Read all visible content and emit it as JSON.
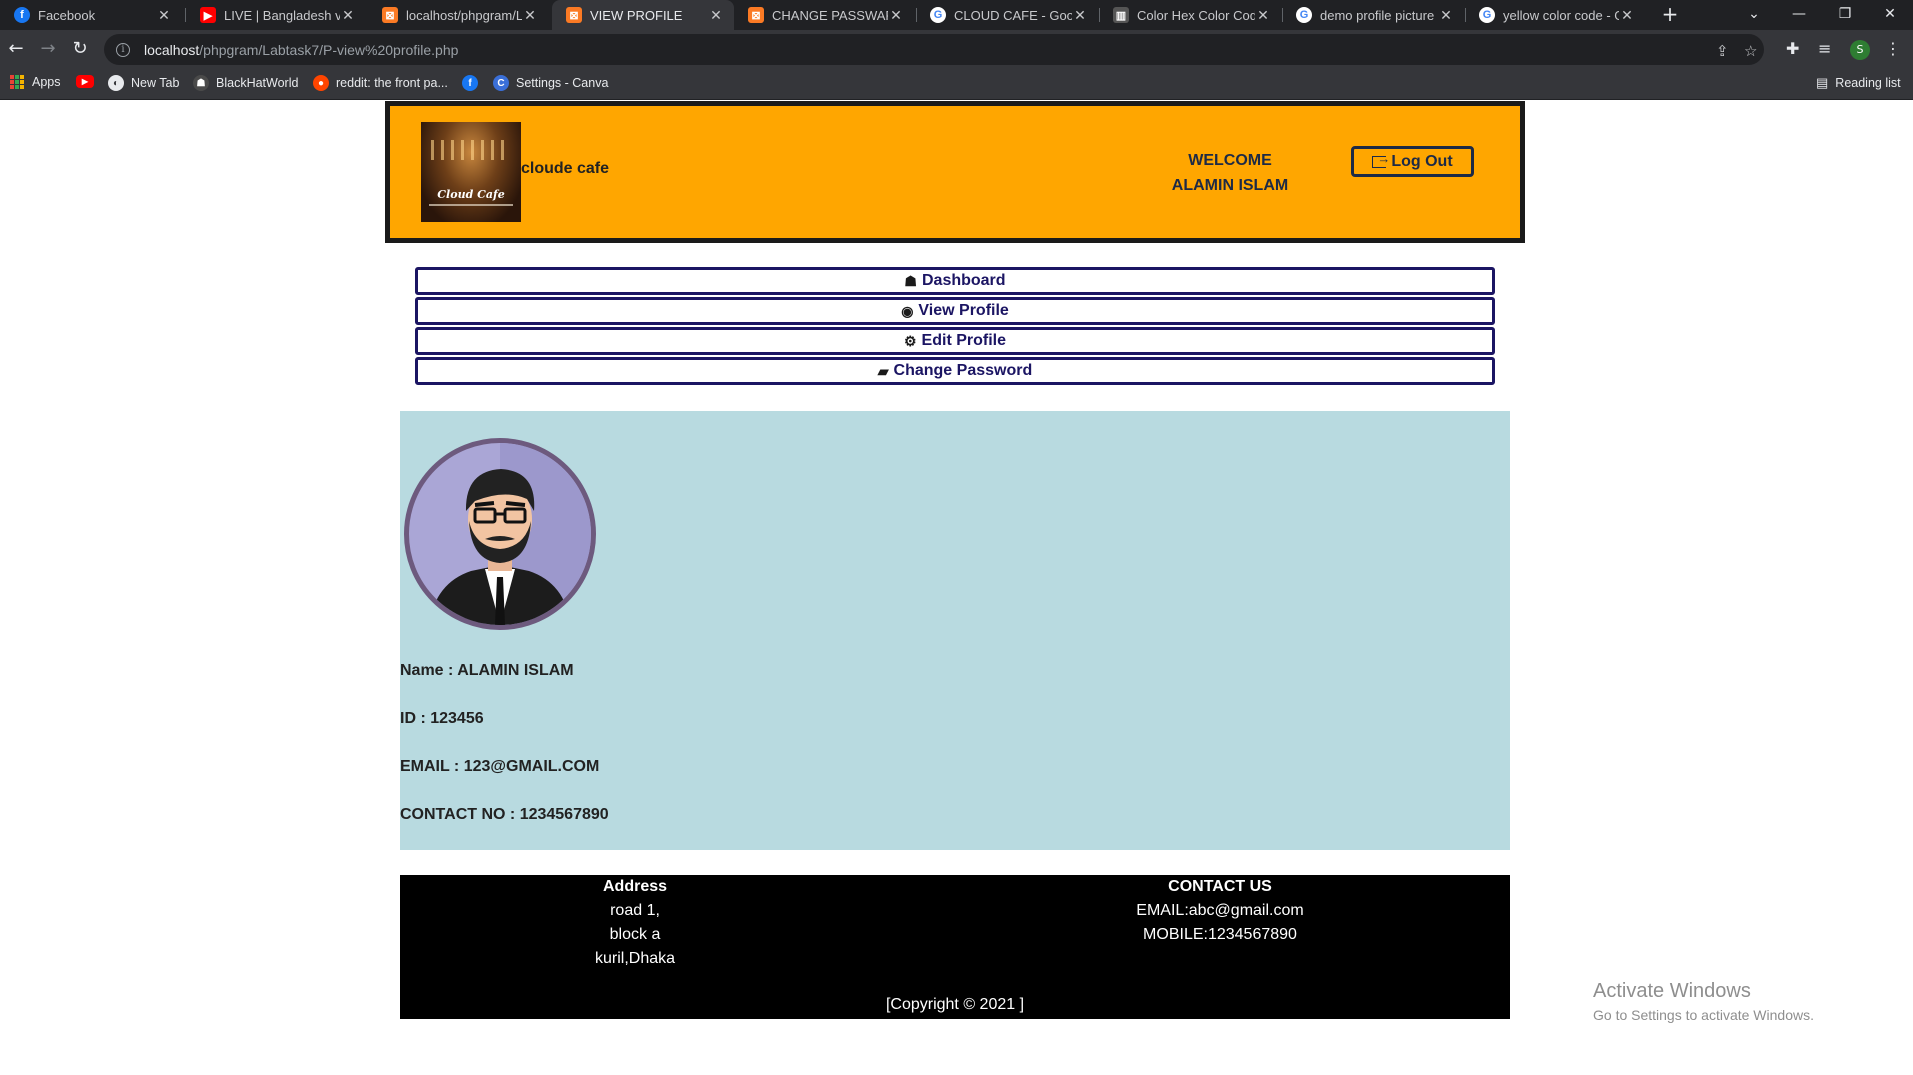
{
  "browser": {
    "tabs": [
      {
        "title": "Facebook",
        "icon": "facebook-favicon",
        "color": "#1877f2"
      },
      {
        "title": "LIVE | Bangladesh vs P",
        "icon": "youtube-favicon",
        "color": "#ff0000"
      },
      {
        "title": "localhost/phpgram/La",
        "icon": "xampp-favicon",
        "color": "#fb7a24"
      },
      {
        "title": "VIEW PROFILE",
        "icon": "xampp-favicon",
        "color": "#fb7a24"
      },
      {
        "title": "CHANGE PASSWARD",
        "icon": "xampp-favicon",
        "color": "#fb7a24"
      },
      {
        "title": "CLOUD CAFE - Google",
        "icon": "google-favicon",
        "color": "#ffffff"
      },
      {
        "title": "Color Hex Color Code",
        "icon": "colorhex-favicon",
        "color": "#555555"
      },
      {
        "title": "demo profile picture",
        "icon": "google-favicon",
        "color": "#ffffff"
      },
      {
        "title": "yellow color code - G",
        "icon": "google-favicon",
        "color": "#ffffff"
      }
    ],
    "url_host": "localhost",
    "url_path": "/phpgram/Labtask7/P-view%20profile.php",
    "bookmarks": [
      {
        "label": "Apps",
        "icon": "apps-grid-icon"
      },
      {
        "label": "",
        "icon": "youtube-icon"
      },
      {
        "label": "New Tab",
        "icon": "new-tab-icon"
      },
      {
        "label": "BlackHatWorld",
        "icon": "blackhatworld-icon"
      },
      {
        "label": "reddit: the front pa...",
        "icon": "reddit-icon"
      },
      {
        "label": "",
        "icon": "facebook-icon"
      },
      {
        "label": "Settings - Canva",
        "icon": "canva-icon"
      }
    ],
    "reading_list": "Reading list",
    "profile_initial": "S"
  },
  "header": {
    "brand": "cloude cafe",
    "logo_caption": "Cloud Cafe",
    "welcome_line1": "WELCOME",
    "welcome_line2": "ALAMIN ISLAM",
    "logout_label": "Log Out",
    "bg_color": "#ffa600"
  },
  "nav": [
    {
      "label": "Dashboard",
      "icon": "home-icon"
    },
    {
      "label": "View Profile",
      "icon": "user-circle-icon"
    },
    {
      "label": "Edit Profile",
      "icon": "gear-icon"
    },
    {
      "label": "Change Password",
      "icon": "book-icon"
    }
  ],
  "profile": {
    "name": "Name : ALAMIN ISLAM",
    "id": "ID : 123456",
    "email": "EMAIL : 123@GMAIL.COM",
    "contact": "CONTACT NO : 1234567890",
    "panel_color": "#b8dae0"
  },
  "footer": {
    "address_title": "Address",
    "address_lines": [
      "road 1,",
      "block a",
      "kuril,Dhaka"
    ],
    "contact_title": "CONTACT US",
    "contact_email": "EMAIL:abc@gmail.com",
    "contact_mobile": "MOBILE:1234567890",
    "copyright": "[Copyright © 2021 ]"
  },
  "watermark": {
    "line1": "Activate Windows",
    "line2": "Go to Settings to activate Windows."
  }
}
